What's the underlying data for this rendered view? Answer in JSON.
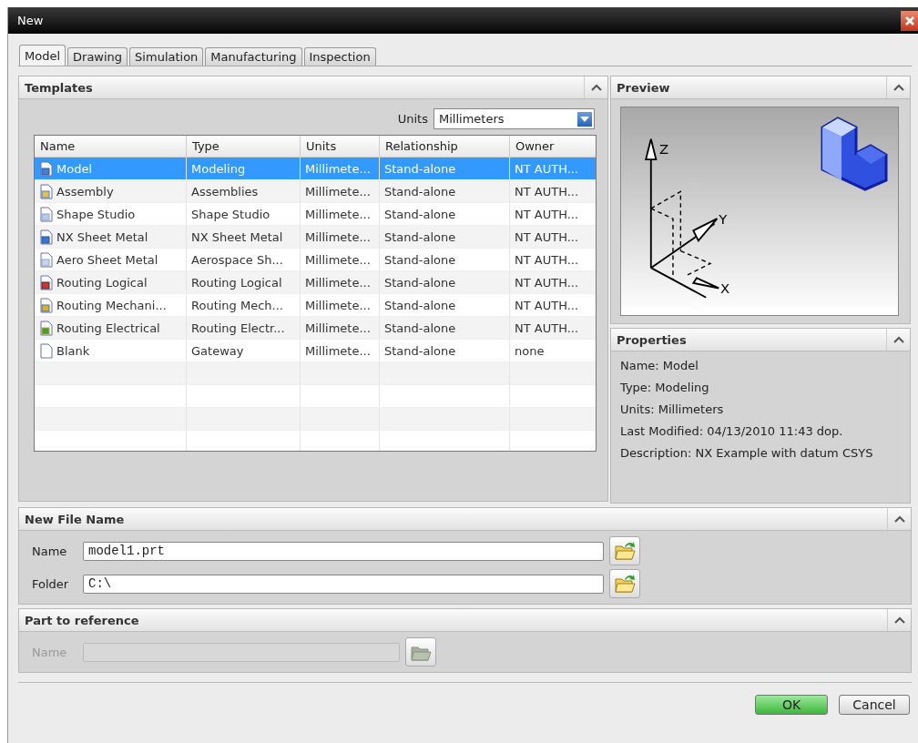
{
  "window": {
    "title": "New"
  },
  "tabs": [
    {
      "label": "Model",
      "selected": true
    },
    {
      "label": "Drawing",
      "selected": false
    },
    {
      "label": "Simulation",
      "selected": false
    },
    {
      "label": "Manufacturing",
      "selected": false
    },
    {
      "label": "Inspection",
      "selected": false
    }
  ],
  "templates": {
    "title": "Templates",
    "units_label": "Units",
    "units_value": "Millimeters",
    "columns": [
      "Name",
      "Type",
      "Units",
      "Relationship",
      "Owner"
    ],
    "rows": [
      {
        "kind": "model",
        "selected": true,
        "cells": [
          "Model",
          "Modeling",
          "Millimete...",
          "Stand-alone",
          "NT AUTH..."
        ]
      },
      {
        "kind": "assembly",
        "selected": false,
        "cells": [
          "Assembly",
          "Assemblies",
          "Millimete...",
          "Stand-alone",
          "NT AUTH..."
        ]
      },
      {
        "kind": "shape",
        "selected": false,
        "cells": [
          "Shape Studio",
          "Shape Studio",
          "Millimete...",
          "Stand-alone",
          "NT AUTH..."
        ]
      },
      {
        "kind": "sheetmetal",
        "selected": false,
        "cells": [
          "NX Sheet Metal",
          "NX Sheet Metal",
          "Millimete...",
          "Stand-alone",
          "NT AUTH..."
        ]
      },
      {
        "kind": "aero",
        "selected": false,
        "cells": [
          "Aero Sheet Metal",
          "Aerospace Sh...",
          "Millimete...",
          "Stand-alone",
          "NT AUTH..."
        ]
      },
      {
        "kind": "logical",
        "selected": false,
        "cells": [
          "Routing Logical",
          "Routing Logical",
          "Millimete...",
          "Stand-alone",
          "NT AUTH..."
        ]
      },
      {
        "kind": "mechanical",
        "selected": false,
        "cells": [
          "Routing Mechani...",
          "Routing Mech...",
          "Millimete...",
          "Stand-alone",
          "NT AUTH..."
        ]
      },
      {
        "kind": "electrical",
        "selected": false,
        "cells": [
          "Routing Electrical",
          "Routing Electr...",
          "Millimete...",
          "Stand-alone",
          "NT AUTH..."
        ]
      },
      {
        "kind": "blank",
        "selected": false,
        "cells": [
          "Blank",
          "Gateway",
          "Millimete...",
          "Stand-alone",
          "none"
        ]
      }
    ]
  },
  "preview": {
    "title": "Preview",
    "axis_labels": [
      "Z",
      "Y",
      "X"
    ]
  },
  "properties": {
    "title": "Properties",
    "lines": [
      "Name: Model",
      "Type: Modeling",
      "Units: Millimeters",
      "Last Modified: 04/13/2010 11:43 dop.",
      "Description: NX Example with datum CSYS"
    ]
  },
  "new_file_name": {
    "title": "New File Name",
    "fields": [
      {
        "label": "Name",
        "value": "model1.prt"
      },
      {
        "label": "Folder",
        "value": "C:\\"
      }
    ]
  },
  "part_to_reference": {
    "title": "Part to reference",
    "disabled": true,
    "fields": [
      {
        "label": "Name"
      }
    ]
  },
  "buttons": [
    {
      "label": "OK",
      "kind": "primary"
    },
    {
      "label": "Cancel",
      "kind": "normal"
    }
  ]
}
